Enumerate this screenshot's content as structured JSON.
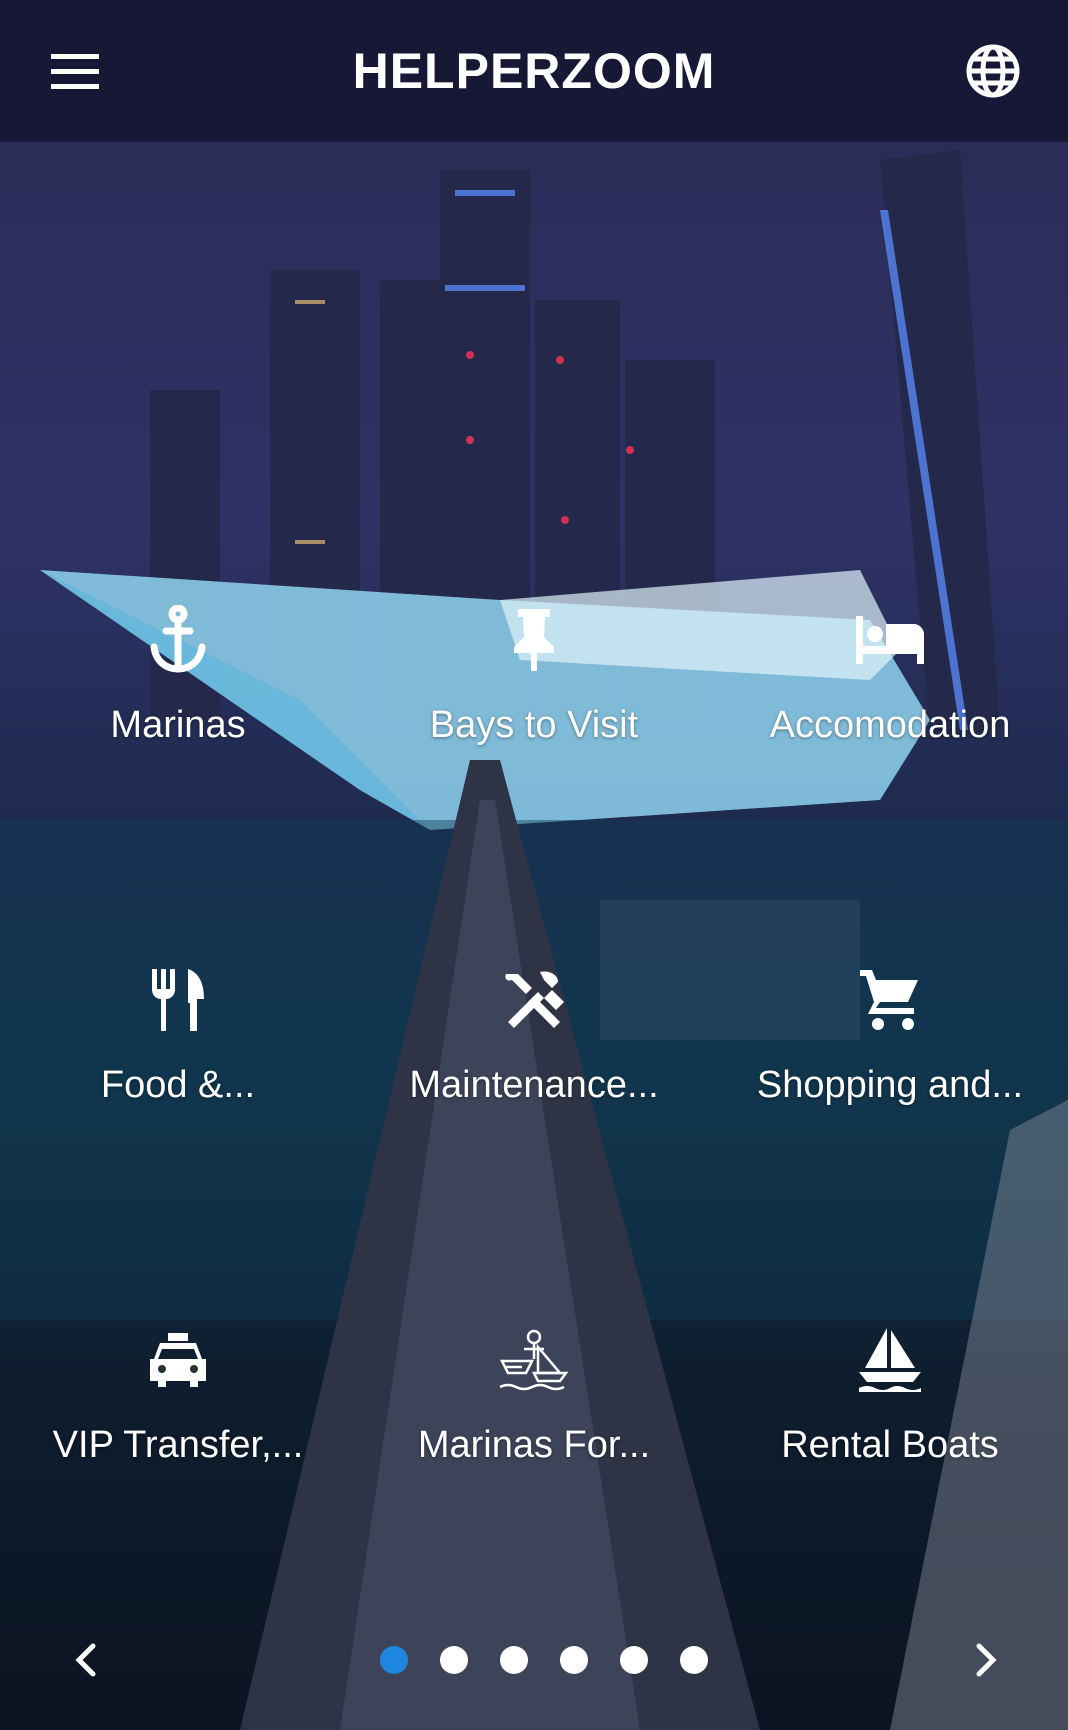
{
  "app": {
    "title": "HELPERZOOM"
  },
  "header": {
    "menu_icon": "menu-icon",
    "language_icon": "globe-icon"
  },
  "services": [
    {
      "label": "Marinas",
      "icon": "anchor-icon"
    },
    {
      "label": "Bays to Visit",
      "icon": "pushpin-icon"
    },
    {
      "label": "Accomodation",
      "icon": "hotel-bed-icon"
    },
    {
      "label": "Food &...",
      "icon": "restaurant-icon"
    },
    {
      "label": "Maintenance...",
      "icon": "tools-icon"
    },
    {
      "label": "Shopping and...",
      "icon": "shopping-cart-icon"
    },
    {
      "label": "VIP Transfer,...",
      "icon": "taxi-icon"
    },
    {
      "label": "Marinas For...",
      "icon": "ship-workers-icon"
    },
    {
      "label": "Rental Boats",
      "icon": "sailboat-icon"
    }
  ],
  "pager": {
    "pages": 6,
    "active_page": 1,
    "prev_icon": "chevron-left-icon",
    "next_icon": "chevron-right-icon"
  },
  "colors": {
    "appbar": "#16163a",
    "active_dot": "#1f86e0",
    "dot": "#ffffff"
  }
}
